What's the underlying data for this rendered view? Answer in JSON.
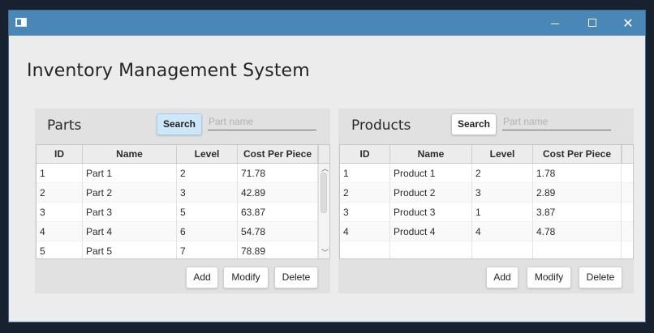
{
  "app_title": "Inventory Management System",
  "parts": {
    "title": "Parts",
    "search_label": "Search",
    "search_placeholder": "Part name",
    "search_value": "",
    "columns": [
      "ID",
      "Name",
      "Level",
      "Cost Per Piece"
    ],
    "rows": [
      [
        "1",
        "Part 1",
        "2",
        "71.78"
      ],
      [
        "2",
        "Part 2",
        "3",
        "42.89"
      ],
      [
        "3",
        "Part 3",
        "5",
        "63.87"
      ],
      [
        "4",
        "Part 4",
        "6",
        "54.78"
      ],
      [
        "5",
        "Part 5",
        "7",
        "78.89"
      ]
    ],
    "add_label": "Add",
    "modify_label": "Modify",
    "delete_label": "Delete"
  },
  "products": {
    "title": "Products",
    "search_label": "Search",
    "search_placeholder": "Part name",
    "search_value": "",
    "columns": [
      "ID",
      "Name",
      "Level",
      "Cost Per Piece"
    ],
    "rows": [
      [
        "1",
        "Product 1",
        "2",
        "1.78"
      ],
      [
        "2",
        "Product 2",
        "3",
        "2.89"
      ],
      [
        "3",
        "Product 3",
        "1",
        "3.87"
      ],
      [
        "4",
        "Product 4",
        "4",
        "4.78"
      ]
    ],
    "add_label": "Add",
    "modify_label": "Modify",
    "delete_label": "Delete"
  },
  "icons": {
    "app": "app-window-icon",
    "minimize": "minimize-icon",
    "maximize": "maximize-icon",
    "close": "close-icon"
  },
  "colors": {
    "titlebar": "#4a87b6",
    "search_active": "#cde6f8",
    "panel_bg": "#e1e1e1",
    "window_bg": "#ececec"
  }
}
